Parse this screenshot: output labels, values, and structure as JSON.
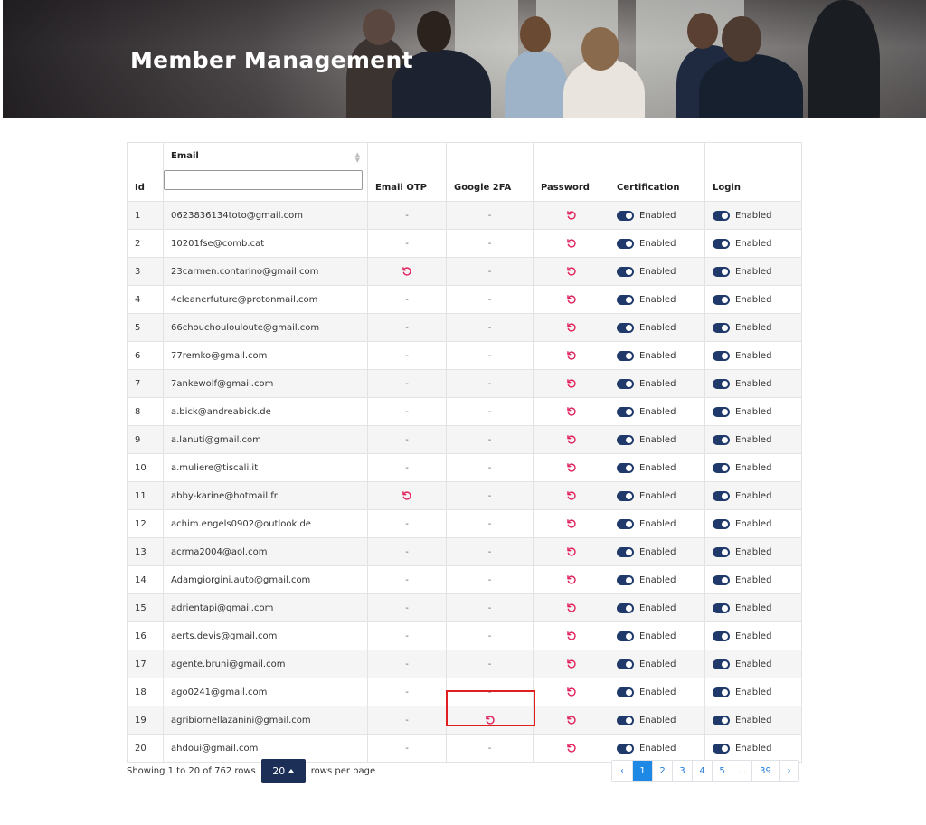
{
  "page": {
    "title": "Member Management"
  },
  "table": {
    "columns": {
      "id": "Id",
      "email": "Email",
      "email_otp": "Email OTP",
      "google_2fa": "Google 2FA",
      "password": "Password",
      "certification": "Certification",
      "login": "Login"
    },
    "email_filter_value": "",
    "dash": "-",
    "enabled_label": "Enabled",
    "rows": [
      {
        "id": "1",
        "email": "0623836134toto@gmail.com",
        "otp": false,
        "g2fa": false
      },
      {
        "id": "2",
        "email": "10201fse@comb.cat",
        "otp": false,
        "g2fa": false
      },
      {
        "id": "3",
        "email": "23carmen.contarino@gmail.com",
        "otp": true,
        "g2fa": false
      },
      {
        "id": "4",
        "email": "4cleanerfuture@protonmail.com",
        "otp": false,
        "g2fa": false
      },
      {
        "id": "5",
        "email": "66chouchoulouloute@gmail.com",
        "otp": false,
        "g2fa": false
      },
      {
        "id": "6",
        "email": "77remko@gmail.com",
        "otp": false,
        "g2fa": false
      },
      {
        "id": "7",
        "email": "7ankewolf@gmail.com",
        "otp": false,
        "g2fa": false
      },
      {
        "id": "8",
        "email": "a.bick@andreabick.de",
        "otp": false,
        "g2fa": false
      },
      {
        "id": "9",
        "email": "a.lanuti@gmail.com",
        "otp": false,
        "g2fa": false
      },
      {
        "id": "10",
        "email": "a.muliere@tiscali.it",
        "otp": false,
        "g2fa": false
      },
      {
        "id": "11",
        "email": "abby-karine@hotmail.fr",
        "otp": true,
        "g2fa": false
      },
      {
        "id": "12",
        "email": "achim.engels0902@outlook.de",
        "otp": false,
        "g2fa": false
      },
      {
        "id": "13",
        "email": "acrma2004@aol.com",
        "otp": false,
        "g2fa": false
      },
      {
        "id": "14",
        "email": "Adamgiorgini.auto@gmail.com",
        "otp": false,
        "g2fa": false
      },
      {
        "id": "15",
        "email": "adrientapi@gmail.com",
        "otp": false,
        "g2fa": false
      },
      {
        "id": "16",
        "email": "aerts.devis@gmail.com",
        "otp": false,
        "g2fa": false
      },
      {
        "id": "17",
        "email": "agente.bruni@gmail.com",
        "otp": false,
        "g2fa": false
      },
      {
        "id": "18",
        "email": "ago0241@gmail.com",
        "otp": false,
        "g2fa": false
      },
      {
        "id": "19",
        "email": "agribiornellazanini@gmail.com",
        "otp": false,
        "g2fa": true
      },
      {
        "id": "20",
        "email": "ahdoui@gmail.com",
        "otp": false,
        "g2fa": false
      }
    ]
  },
  "footer": {
    "showing_text": "Showing 1 to 20 of 762 rows",
    "page_size": "20",
    "rows_per_page_text": "rows per page"
  },
  "pagination": {
    "prev": "‹",
    "pages": [
      "1",
      "2",
      "3",
      "4",
      "5"
    ],
    "ellipsis": "...",
    "last": "39",
    "next": "›",
    "active_page": "1"
  },
  "colors": {
    "reset_icon": "#e0245e",
    "toggle": "#1f3a6a",
    "page_size_button": "#1b2f57",
    "active_page": "#1e88e5",
    "highlight": "#e02020"
  },
  "icons": {
    "reset": "rotate-ccw-icon",
    "sort": "sort-icon",
    "caret": "caret-up-icon"
  }
}
